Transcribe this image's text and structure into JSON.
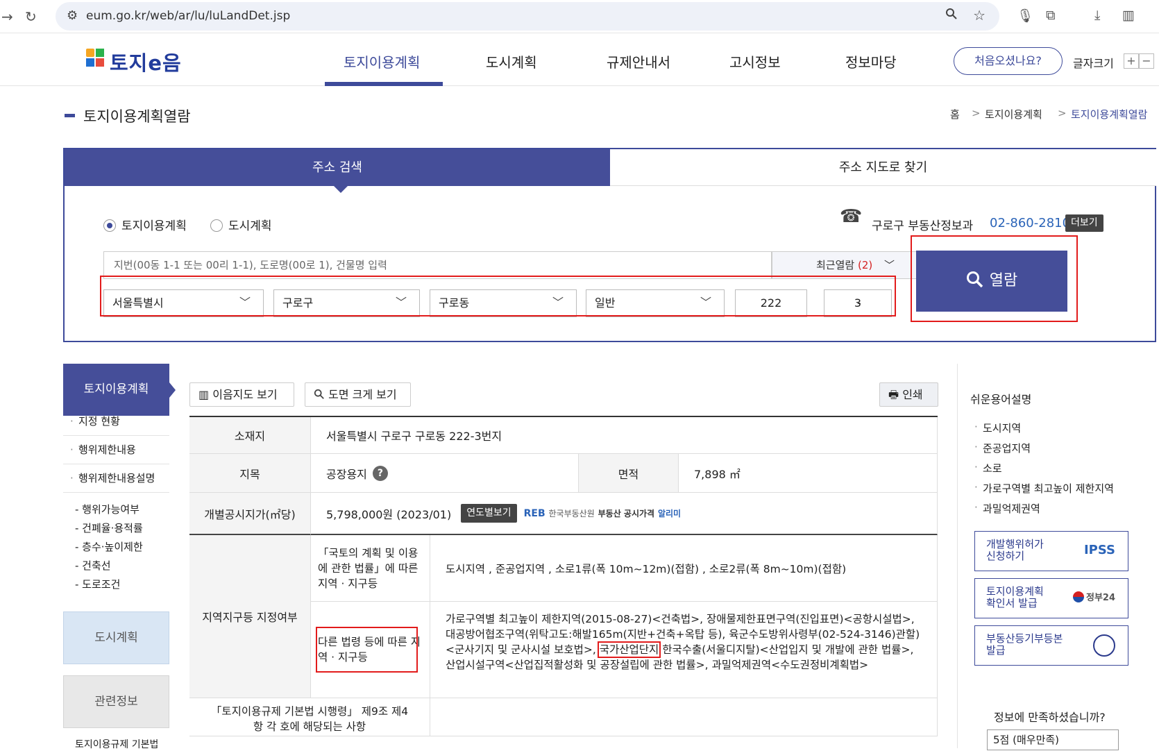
{
  "browser": {
    "url": "eum.go.kr/web/ar/lu/luLandDet.jsp"
  },
  "header": {
    "logo_text": "토지e음",
    "nav": [
      "토지이용계획",
      "도시계획",
      "규제안내서",
      "고시정보",
      "정보마당"
    ],
    "first_visit": "처음오셨나요?",
    "font_size_label": "글자크기",
    "plus": "+",
    "minus": "−"
  },
  "page": {
    "title": "토지이용계획열람",
    "breadcrumb": [
      "홈",
      "토지이용계획",
      "토지이용계획열람"
    ],
    "bc_sep": ">"
  },
  "search": {
    "tab_address": "주소 검색",
    "tab_map": "주소 지도로 찾기",
    "radio_land": "토지이용계획",
    "radio_city": "도시계획",
    "phone_label": "구로구 부동산정보과",
    "phone_number": "02-860-2810",
    "more": "더보기",
    "placeholder": "지번(00동 1-1 또는 00리 1-1), 도로명(00로 1), 건물명 입력",
    "recent_label": "최근열람",
    "recent_count": "(2)",
    "sido": "서울특별시",
    "sigungu": "구로구",
    "dong": "구로동",
    "land_type": "일반",
    "bonbun": "222",
    "dash": "-",
    "bubun": "3",
    "view_button": "열람"
  },
  "left_menu": {
    "head": "토지이용계획",
    "items": [
      "지정 현황",
      "행위제한내용",
      "행위제한내용설명"
    ],
    "subs": [
      "- 행위가능여부",
      "- 건폐율·용적률",
      "- 층수·높이제한",
      "- 건축선",
      "- 도로조건"
    ],
    "city": "도시계획",
    "related": "관련정보",
    "cutoff": "토지이용규제 기본법"
  },
  "tools": {
    "map_view": "이음지도 보기",
    "zoom_view": "도면 크게 보기",
    "print": "인쇄"
  },
  "table": {
    "location_h": "소재지",
    "location_v": "서울특별시 구로구 구로동 222-3번지",
    "jimok_h": "지목",
    "jimok_v": "공장용지",
    "help": "?",
    "area_h": "면적",
    "area_v": "7,898 ㎡",
    "price_h": "개별공시지가(㎡당)",
    "price_v": "5,798,000원 (2023/01)",
    "year_btn": "연도별보기",
    "reb_logo": "REB",
    "reb_org": "한국부동산원",
    "reb_b": "부동산 공시가격",
    "reb_p": "알리미",
    "zone_h": "지역지구등 지정여부",
    "law1_h": "「국토의 계획 및 이용에 관한 법률」에 따른 지역 · 지구등",
    "law1_v": "도시지역 , 준공업지역 , 소로1류(폭 10m~12m)(접함) , 소로2류(폭 8m~10m)(접함)",
    "law2_h": "다른 법령 등에 따른 지역 · 지구등",
    "law2_v": "가로구역별 최고높이 제한지역(2015-08-27)<건축법>, 장애물제한표면구역(진입표면)<공항시설법>, 대공방어협조구역(위탁고도:해발165m(지반+건축+옥탑 등), 육군수도방위사령부(02-524-3146)관할)<군사기지 및 군사시설 보호법>, 국가산업단지 한국수출(서울디지탈)<산업입지 및 개발에 관한 법률>, 산업시설구역<산업집적활성화 및 공장설립에 관한 법률>, 과밀억제권역<수도권정비계획법>",
    "law2_v_pre": "가로구역별 최고높이 제한지역(2015-08-27)<건축법>, 장애물제한표면구역(진입표면)<공항시설법>, 대공방어협조구역(위탁고도:해발165m(지반+건축+옥탑 등), 육군수도방위사령부(02-524-3146)관할)<군사기지 및 군사시설 보호법>, ",
    "law2_v_hl": "국가산업단지",
    "law2_v_post": " 한국수출(서울디지탈)<산업입지 및 개발에 관한 법률>, 산업시설구역<산업집적활성화 및 공장설립에 관한 법률>, 과밀억제권역<수도권정비계획법>",
    "enf_h": "「토지이용규제 기본법 시행령」 제9조 제4항 각 호에 해당되는 사항"
  },
  "right_panel": {
    "title": "쉬운용어설명",
    "terms": [
      "도시지역",
      "준공업지역",
      "소로",
      "가로구역별 최고높이 제한지역",
      "과밀억제권역"
    ],
    "cards": [
      {
        "label": "개발행위허가 신청하기",
        "logo": "IPSS"
      },
      {
        "label": "토지이용계획 확인서 발급",
        "logo": "정부24"
      },
      {
        "label": "부동산등기부등본 발급",
        "logo": ""
      }
    ],
    "survey_q": "정보에 만족하셨습니까?",
    "survey_sel": "5점 (매우만족)"
  },
  "colors": {
    "primary": "#454e99",
    "highlight": "#e21b1b",
    "link": "#2a63b8"
  }
}
